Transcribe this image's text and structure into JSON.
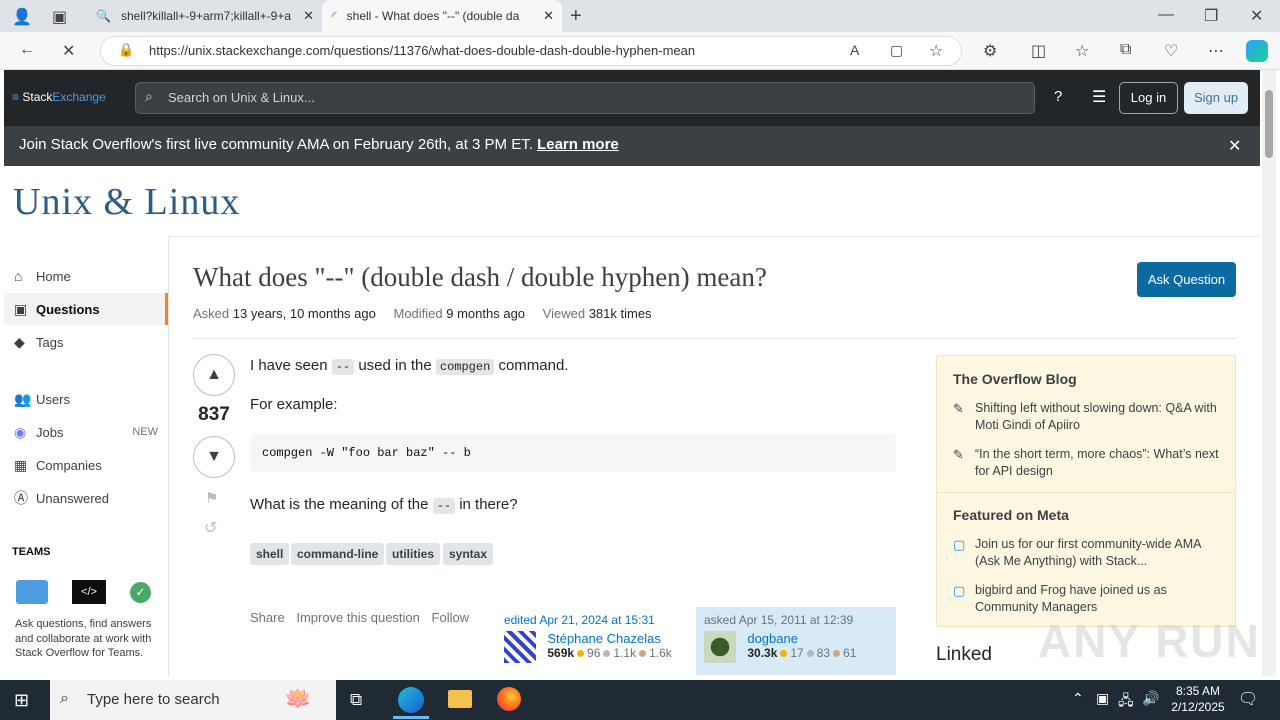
{
  "browser": {
    "tabs": [
      {
        "label": "shell?killall+-9+arm7;killall+-9+a"
      },
      {
        "label": "shell - What does \"--\" (double da"
      }
    ],
    "url": "https://unix.stackexchange.com/questions/11376/what-does-double-dash-double-hyphen-mean"
  },
  "site": {
    "brand_stack": "Stack",
    "brand_exchange": "Exchange",
    "search_placeholder": "Search on Unix & Linux...",
    "login_label": "Log in",
    "signup_label": "Sign up",
    "banner_text": "Join Stack Overflow's first live community AMA on February 26th, at 3 PM ET.",
    "banner_link": "Learn more",
    "logo": "Unix & Linux"
  },
  "nav": {
    "items": [
      {
        "label": "Home",
        "icon": "home-icon"
      },
      {
        "label": "Questions",
        "icon": "questions-icon"
      },
      {
        "label": "Tags",
        "icon": "tag-icon"
      },
      {
        "label": "Users",
        "icon": "users-icon"
      },
      {
        "label": "Jobs",
        "icon": "jobs-icon",
        "badge": "NEW"
      },
      {
        "label": "Companies",
        "icon": "companies-icon"
      },
      {
        "label": "Unanswered",
        "icon": "unanswered-icon"
      }
    ],
    "teams_heading": "TEAMS",
    "teams_desc": "Ask questions, find answers and collaborate at work with Stack Overflow for Teams."
  },
  "question": {
    "title": "What does \"--\" (double dash / double hyphen) mean?",
    "ask_button": "Ask Question",
    "asked_label": "Asked",
    "asked_value": "13 years, 10 months ago",
    "modified_label": "Modified",
    "modified_value": "9 months ago",
    "viewed_label": "Viewed",
    "viewed_value": "381k times",
    "score": "837",
    "p1_a": "I have seen",
    "p1_code1": "--",
    "p1_b": "used in the",
    "p1_code2": "compgen",
    "p1_c": "command.",
    "p2": "For example:",
    "code_block": "compgen -W \"foo bar baz\" -- b",
    "p3_a": "What is the meaning of the",
    "p3_code": "--",
    "p3_b": "in there?",
    "tags": [
      "shell",
      "command-line",
      "utilities",
      "syntax"
    ],
    "share": "Share",
    "improve": "Improve this question",
    "follow": "Follow",
    "edited": {
      "label": "edited Apr 21, 2024 at 15:31",
      "name": "Stéphane Chazelas",
      "rep": "569k",
      "gold": "96",
      "silver": "1.1k",
      "bronze": "1.6k"
    },
    "asked": {
      "label": "asked Apr 15, 2011 at 12:39",
      "name": "dogbane",
      "rep": "30.3k",
      "gold": "17",
      "silver": "83",
      "bronze": "61"
    }
  },
  "sidebar": {
    "blog_title": "The Overflow Blog",
    "blog_items": [
      "Shifting left without slowing down: Q&A with Moti Gindi of Apiiro",
      "“In the short term, more chaos”: What’s next for API design"
    ],
    "meta_title": "Featured on Meta",
    "meta_items": [
      "Join us for our first community-wide AMA (Ask Me Anything) with Stack...",
      "bigbird and Frog have joined us as Community Managers"
    ],
    "linked": "Linked"
  },
  "taskbar": {
    "search_placeholder": "Type here to search",
    "time": "8:35 AM",
    "date": "2/12/2025"
  },
  "watermark": "ANY RUN",
  "colors": {
    "accent": "#0a6aa1",
    "topbar": "#232629",
    "banner": "#3b4045"
  }
}
